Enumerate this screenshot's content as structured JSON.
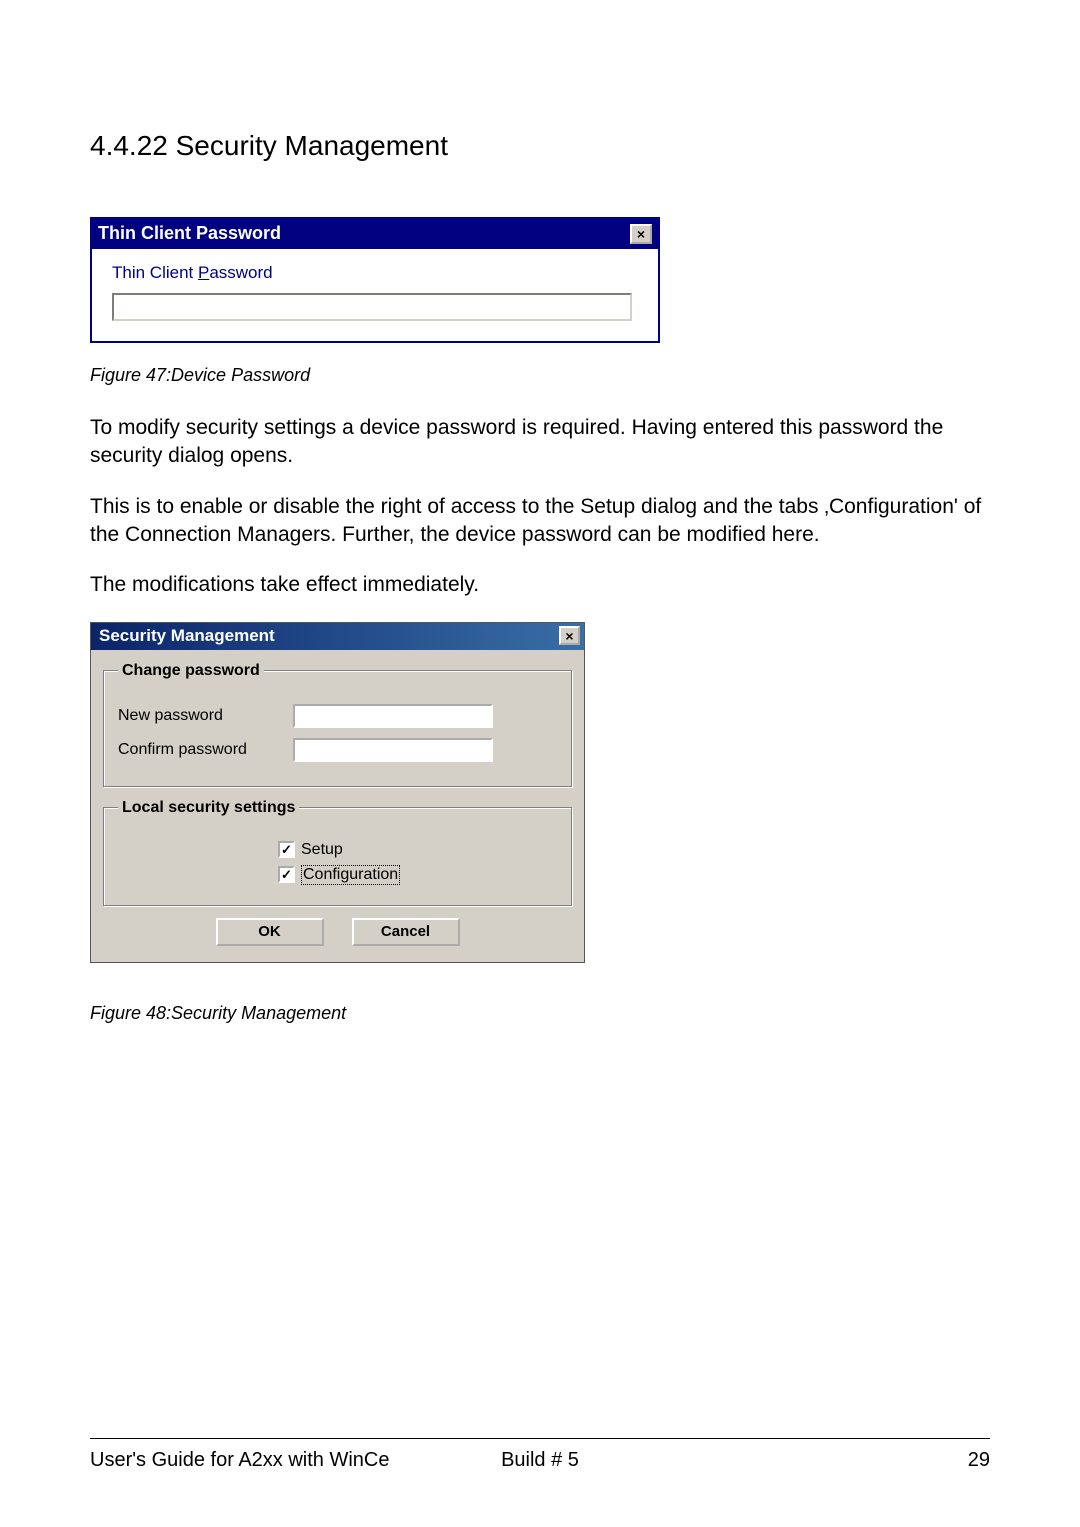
{
  "heading": "4.4.22 Security Management",
  "dialog1": {
    "title": "Thin Client Password",
    "close": "×",
    "label_prefix": "Thin Client ",
    "label_accel": "P",
    "label_suffix": "assword",
    "input_value": ""
  },
  "figure47": "Figure 47:Device Password",
  "paragraphs": {
    "p1": "To modify security settings a device password is required. Having entered this password the security dialog opens.",
    "p2": "This is to enable or disable the right of access to the Setup dialog and the tabs ‚Configuration' of the Connection Managers. Further, the device password can be modified here.",
    "p3": "The modifications take effect immediately."
  },
  "dialog2": {
    "title": "Security Management",
    "close": "×",
    "group1": {
      "legend": "Change password",
      "new_label": "New password",
      "confirm_label": "Confirm password",
      "new_value": "",
      "confirm_value": ""
    },
    "group2": {
      "legend": "Local security settings",
      "setup_label": "Setup",
      "setup_check": "✓",
      "config_label": "Configuration",
      "config_check": "✓"
    },
    "ok": "OK",
    "cancel": "Cancel"
  },
  "figure48": "Figure 48:Security Management",
  "footer": {
    "left": "User's Guide for A2xx with WinCe",
    "center": "Build # 5",
    "right": "29"
  }
}
